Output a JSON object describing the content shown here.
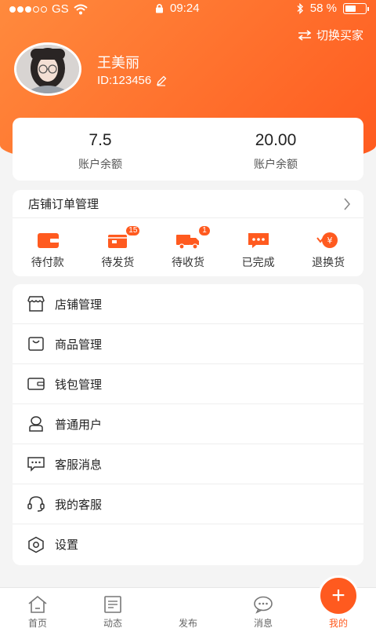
{
  "status_bar": {
    "carrier": "GS",
    "time": "09:24",
    "battery_text": "58 %",
    "battery_level": 0.58
  },
  "header": {
    "switch_label": "切换买家",
    "user_name": "王美丽",
    "user_id": "ID:123456"
  },
  "balances": [
    {
      "value": "7.5",
      "label": "账户余额"
    },
    {
      "value": "20.00",
      "label": "账户余额"
    }
  ],
  "orders": {
    "title": "店铺订单管理",
    "items": [
      {
        "label": "待付款",
        "icon": "wallet-icon",
        "badge": ""
      },
      {
        "label": "待发货",
        "icon": "package-icon",
        "badge": "15"
      },
      {
        "label": "待收货",
        "icon": "truck-icon",
        "badge": "1"
      },
      {
        "label": "已完成",
        "icon": "chat-dots-icon",
        "badge": ""
      },
      {
        "label": "退换货",
        "icon": "refund-icon",
        "badge": ""
      }
    ]
  },
  "menu": [
    {
      "label": "店铺管理",
      "icon": "store-icon"
    },
    {
      "label": "商品管理",
      "icon": "bag-icon"
    },
    {
      "label": "钱包管理",
      "icon": "wallet-icon"
    },
    {
      "label": "普通用户",
      "icon": "user-icon"
    },
    {
      "label": "客服消息",
      "icon": "message-icon"
    },
    {
      "label": "我的客服",
      "icon": "headset-icon"
    },
    {
      "label": "设置",
      "icon": "hexagon-settings-icon"
    }
  ],
  "tabbar": {
    "items": [
      {
        "label": "首页",
        "icon": "home-icon"
      },
      {
        "label": "动态",
        "icon": "news-icon"
      },
      {
        "label": "发布",
        "icon": "plus-icon"
      },
      {
        "label": "消息",
        "icon": "chat-bubble-icon"
      },
      {
        "label": "我的",
        "icon": "smile-icon"
      }
    ],
    "active": "我的"
  },
  "colors": {
    "accent": "#ff5a1f",
    "accent_light": "#ff8a3d"
  }
}
